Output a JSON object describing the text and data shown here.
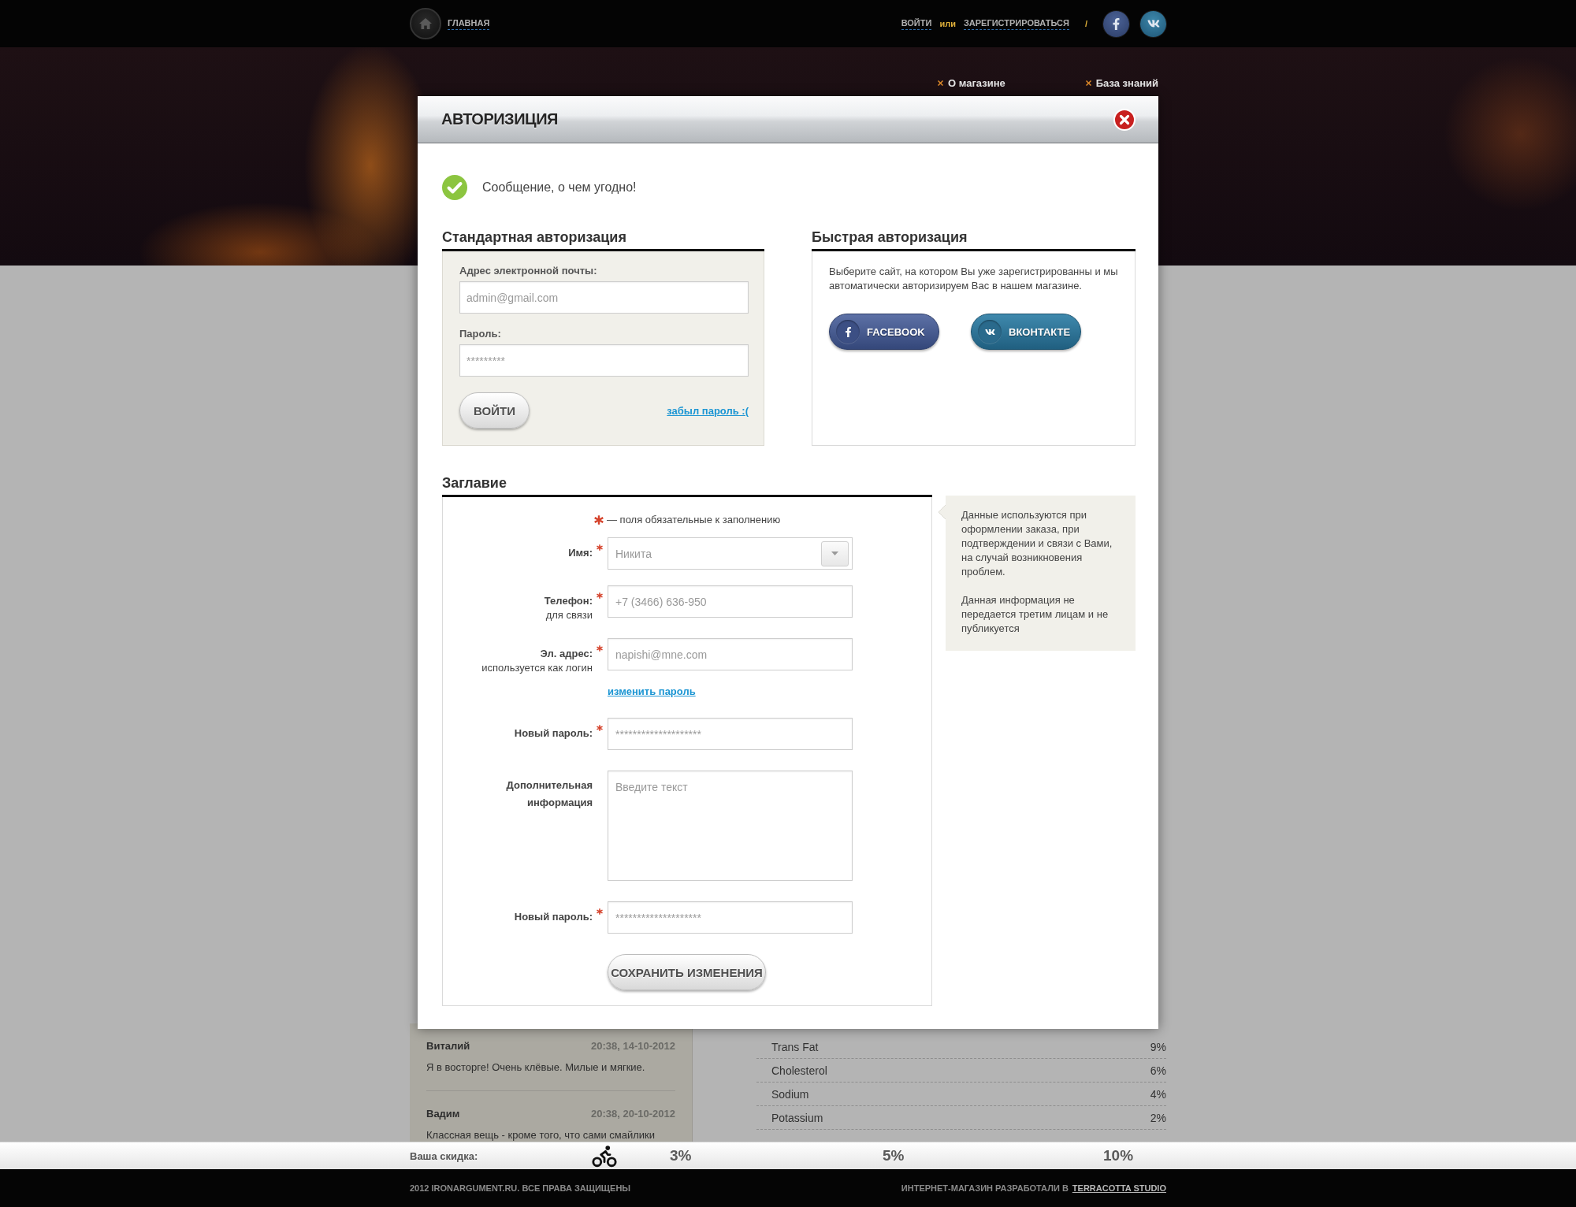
{
  "top_bar": {
    "home_link": "ГЛАВНАЯ",
    "login_link": "ВОЙТИ",
    "or_text": "или",
    "register_link": "ЗАРЕГИСТРИРОВАТЬСЯ",
    "divider": "/"
  },
  "hero": {
    "menu": [
      "О магазине",
      "База знаний"
    ]
  },
  "modal": {
    "title": "АВТОРИЗИЦИЯ",
    "message": "Сообщение, о чем угодно!",
    "standard_auth": {
      "heading": "Стандартная авторизация",
      "fields": [
        {
          "label": "Адрес электронной почты:",
          "placeholder": "admin@gmail.com"
        },
        {
          "label": "Пароль:",
          "placeholder": "*********"
        }
      ],
      "submit": "ВОЙТИ",
      "forgot_link": "забыл пароль :("
    },
    "quick_auth": {
      "heading": "Быстрая авторизация",
      "text": "Выберите сайт, на котором Вы уже зарегистрированны и мы автоматически авторизируем Вас в нашем магазине.",
      "buttons": [
        {
          "kind": "facebook",
          "label": "FACEBOOK"
        },
        {
          "kind": "vk",
          "label": "ВКОНТАКТЕ"
        }
      ]
    },
    "profile": {
      "heading": "Заглавие",
      "required_note": "— поля обязательные к заполнению",
      "rows": [
        {
          "kind": "select",
          "label": "Имя:",
          "required": true,
          "placeholder": "Никита"
        },
        {
          "kind": "input",
          "label": "Телефон:",
          "sublabel": "для связи",
          "required": true,
          "placeholder": "+7 (3466) 636-950"
        },
        {
          "kind": "input",
          "label": "Эл. адрес:",
          "sublabel": "используется как логин",
          "required": true,
          "placeholder": "napishi@mne.com"
        },
        {
          "kind": "link",
          "label": "изменить пароль"
        },
        {
          "kind": "input",
          "label": "Новый пароль:",
          "required": true,
          "placeholder": "********************"
        },
        {
          "kind": "textarea",
          "label": "Дополнительная информация",
          "required": false,
          "placeholder": "Введите текст"
        },
        {
          "kind": "input",
          "label": "Новый пароль:",
          "required": true,
          "placeholder": "********************"
        },
        {
          "kind": "button",
          "label": "СОХРАНИТЬ ИЗМЕНЕНИЯ"
        }
      ],
      "hint": [
        "Данные используются при оформлении заказа, при подтверждении и связи с Вами, на случай возникновения проблем.",
        "Данная информация не передается третим лицам и не публикуется"
      ]
    }
  },
  "comments": [
    {
      "author": "Виталий",
      "date": "20:38, 14-10-2012",
      "text": "Я в восторге! Очень клёвые. Милые и мягкие."
    },
    {
      "author": "Вадим",
      "date": "20:38, 20-10-2012",
      "text": "Классная вещь - кроме того, что сами смайлики"
    }
  ],
  "nutrition": [
    {
      "name": "Trans Fat",
      "value": "9%"
    },
    {
      "name": "Cholesterol",
      "value": "6%"
    },
    {
      "name": "Sodium",
      "value": "4%"
    },
    {
      "name": "Potassium",
      "value": "2%"
    }
  ],
  "discount_bar": {
    "label": "Ваша скидка:",
    "levels": [
      "3%",
      "5%",
      "10%"
    ]
  },
  "footer": {
    "copyright": "2012 IRONARGUMENT.RU. ВСЕ ПРАВА ЗАЩИЩЕНЫ",
    "credit": "ИНТЕРНЕТ-МАГАЗИН РАЗРАБОТАЛИ В",
    "studio_link": "TERRACOTTA STUDIO"
  }
}
